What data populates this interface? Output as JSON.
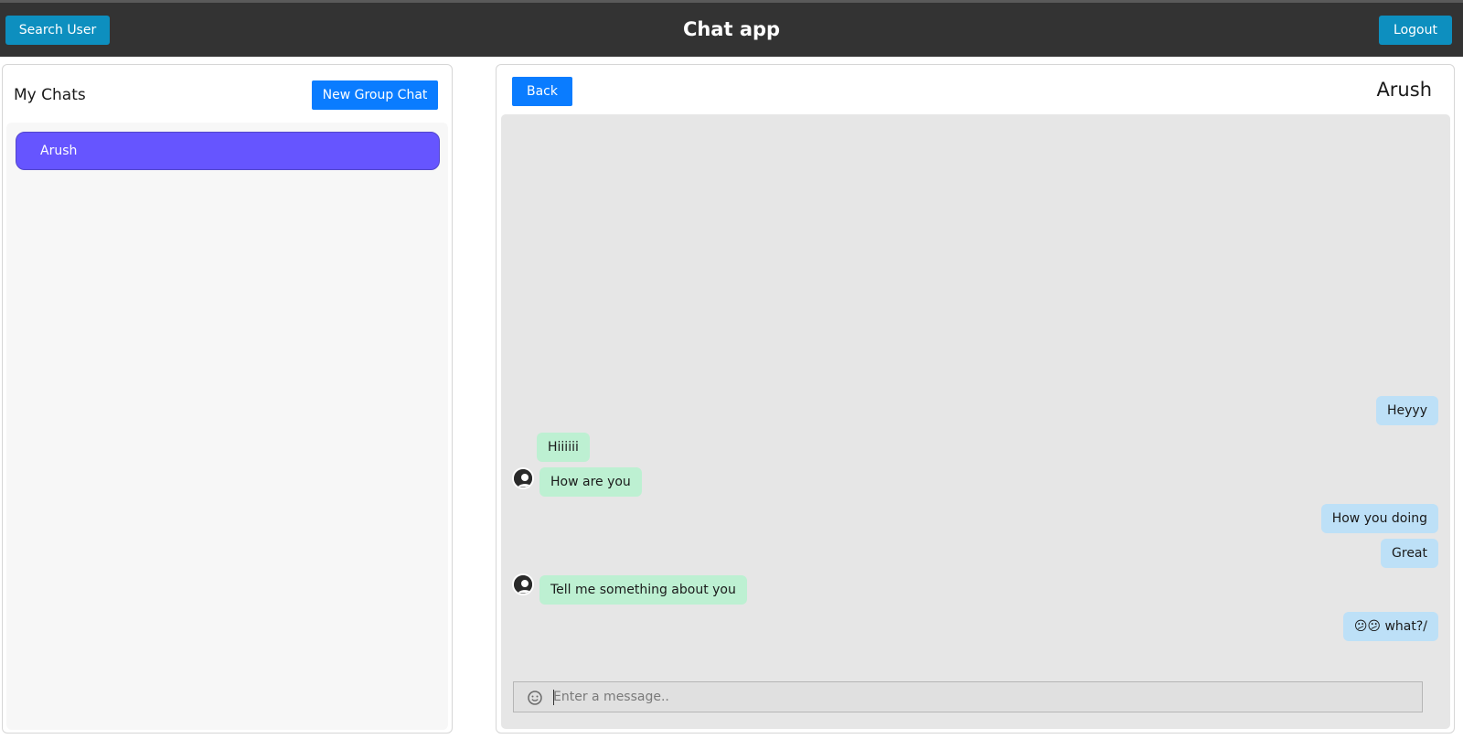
{
  "header": {
    "title": "Chat app",
    "search_label": "Search User",
    "logout_label": "Logout"
  },
  "sidebar": {
    "title": "My Chats",
    "new_group_label": "New Group Chat",
    "chats": [
      {
        "name": "Arush",
        "selected": true
      }
    ]
  },
  "conversation": {
    "back_label": "Back",
    "contact_name": "Arush",
    "messages": [
      {
        "text": "Heyyy",
        "direction": "sent"
      },
      {
        "text": "Hiiiiii",
        "direction": "received"
      },
      {
        "text": "How are you",
        "direction": "received"
      },
      {
        "text": "How you doing",
        "direction": "sent"
      },
      {
        "text": "Great",
        "direction": "sent"
      },
      {
        "text": "Tell me something about you",
        "direction": "received"
      },
      {
        "text": "😕😕 what?/",
        "direction": "sent"
      }
    ],
    "input_placeholder": "Enter a message.."
  },
  "colors": {
    "topbar": "#333333",
    "top_button": "#0d8fbf",
    "primary_button": "#0a7cff",
    "selected_chat": "#6655ff",
    "sent_bubble": "#bde0f7",
    "received_bubble": "#bdf0d2",
    "messages_bg": "#e6e6e6"
  },
  "icons": {
    "emoji": "smiley-icon",
    "avatar": "user-avatar-icon"
  }
}
